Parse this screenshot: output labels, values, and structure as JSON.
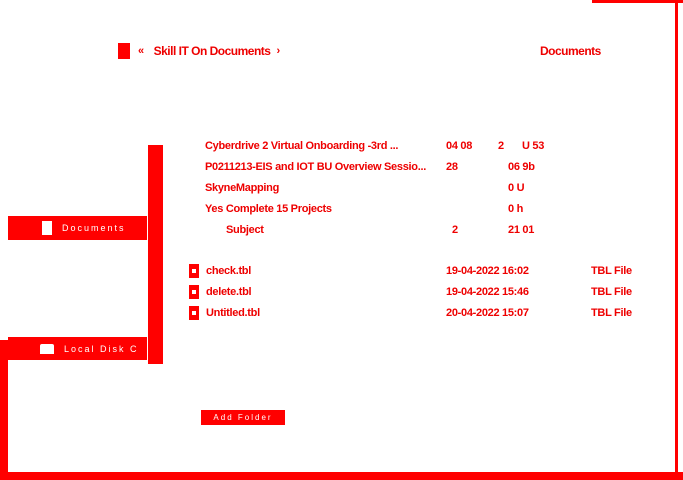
{
  "breadcrumb": {
    "back_icon": "back-arrow-icon",
    "forward_icon": "forward-arrow-icon",
    "path": "Skill  IT  On  Documents"
  },
  "current_folder": "Documents",
  "sidebar": {
    "items": [
      {
        "label": "Documents",
        "icon": "document-icon"
      },
      {
        "label": "Local Disk C",
        "icon": "drive-icon"
      }
    ]
  },
  "folders": [
    {
      "name": "Cyberdrive 2 Virtual Onboarding -3rd ...",
      "date": "04 08",
      "type": "2",
      "size": "U 53"
    },
    {
      "name": "P0211213-EIS and IOT BU Overview Sessio...",
      "date": "28",
      "type": "",
      "size": "06 9b"
    },
    {
      "name": "SkyneMapping",
      "date": "",
      "type": "",
      "size": "0  U"
    },
    {
      "name": "Yes Complete 15 Projects",
      "date": "",
      "type": "",
      "size": "0  h"
    },
    {
      "name": "Subject",
      "date": "2",
      "type": "",
      "size": "21 01"
    }
  ],
  "files": [
    {
      "name": "check.tbl",
      "date": "19-04-2022 16:02",
      "type": "TBL File",
      "icon": "tbl-file-icon"
    },
    {
      "name": "delete.tbl",
      "date": "19-04-2022 15:46",
      "type": "TBL File",
      "icon": "tbl-file-icon"
    },
    {
      "name": "Untitled.tbl",
      "date": "20-04-2022 15:07",
      "type": "TBL File",
      "icon": "tbl-file-icon"
    }
  ],
  "bottom_button": "Add Folder",
  "accent_color": "#ff0000"
}
